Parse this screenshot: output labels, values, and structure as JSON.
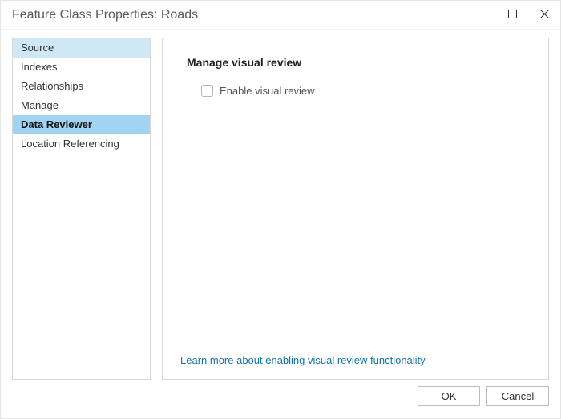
{
  "window": {
    "title": "Feature Class Properties: Roads"
  },
  "sidebar": {
    "items": [
      {
        "label": "Source"
      },
      {
        "label": "Indexes"
      },
      {
        "label": "Relationships"
      },
      {
        "label": "Manage"
      },
      {
        "label": "Data Reviewer"
      },
      {
        "label": "Location Referencing"
      }
    ]
  },
  "panel": {
    "heading": "Manage visual review",
    "checkbox_label": "Enable visual review",
    "checkbox_checked": false,
    "help_link": "Learn more about enabling visual review functionality"
  },
  "footer": {
    "ok": "OK",
    "cancel": "Cancel"
  }
}
